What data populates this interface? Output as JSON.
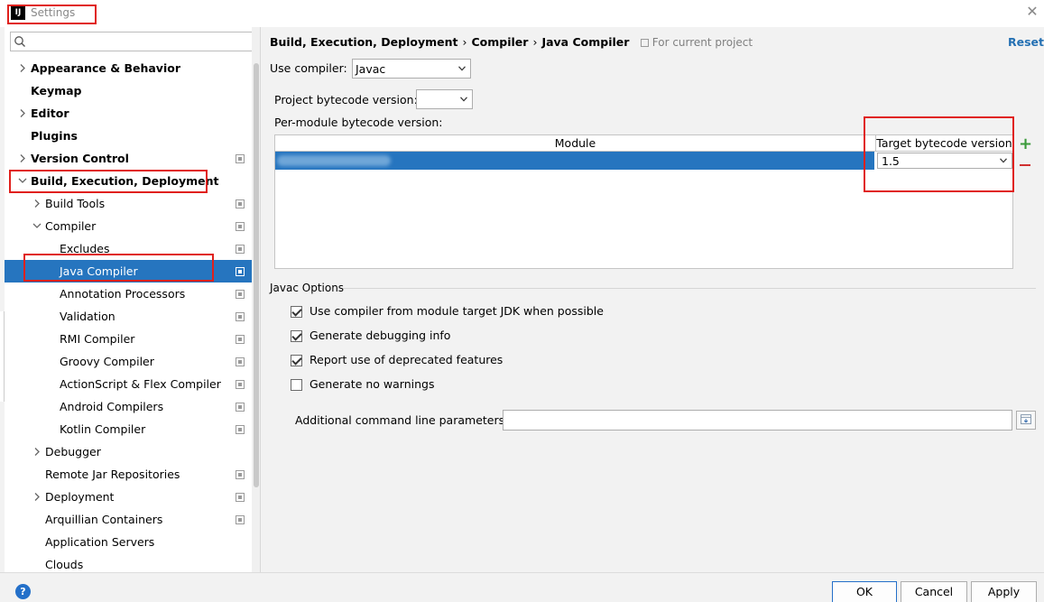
{
  "window": {
    "title": "Settings",
    "logo_text": "IJ",
    "close_glyph": "✕"
  },
  "search": {
    "placeholder": ""
  },
  "sidebar": {
    "items": [
      {
        "label": "Appearance & Behavior",
        "bold": true,
        "chevron": "right",
        "project_icon": false
      },
      {
        "label": "Keymap",
        "bold": true,
        "chevron": "none",
        "project_icon": false
      },
      {
        "label": "Editor",
        "bold": true,
        "chevron": "right",
        "project_icon": false
      },
      {
        "label": "Plugins",
        "bold": true,
        "chevron": "none",
        "project_icon": false
      },
      {
        "label": "Version Control",
        "bold": true,
        "chevron": "right",
        "project_icon": true
      },
      {
        "label": "Build, Execution, Deployment",
        "bold": true,
        "chevron": "down",
        "project_icon": false
      },
      {
        "label": "Build Tools",
        "bold": false,
        "chevron": "right",
        "project_icon": true
      },
      {
        "label": "Compiler",
        "bold": false,
        "chevron": "down",
        "project_icon": true
      },
      {
        "label": "Excludes",
        "bold": false,
        "chevron": "none",
        "project_icon": true
      },
      {
        "label": "Java Compiler",
        "bold": false,
        "chevron": "none",
        "project_icon": true,
        "selected": true
      },
      {
        "label": "Annotation Processors",
        "bold": false,
        "chevron": "none",
        "project_icon": true
      },
      {
        "label": "Validation",
        "bold": false,
        "chevron": "none",
        "project_icon": true
      },
      {
        "label": "RMI Compiler",
        "bold": false,
        "chevron": "none",
        "project_icon": true
      },
      {
        "label": "Groovy Compiler",
        "bold": false,
        "chevron": "none",
        "project_icon": true
      },
      {
        "label": "ActionScript & Flex Compiler",
        "bold": false,
        "chevron": "none",
        "project_icon": true
      },
      {
        "label": "Android Compilers",
        "bold": false,
        "chevron": "none",
        "project_icon": true
      },
      {
        "label": "Kotlin Compiler",
        "bold": false,
        "chevron": "none",
        "project_icon": true
      },
      {
        "label": "Debugger",
        "bold": false,
        "chevron": "right",
        "project_icon": false
      },
      {
        "label": "Remote Jar Repositories",
        "bold": false,
        "chevron": "none",
        "project_icon": true
      },
      {
        "label": "Deployment",
        "bold": false,
        "chevron": "right",
        "project_icon": true
      },
      {
        "label": "Arquillian Containers",
        "bold": false,
        "chevron": "none",
        "project_icon": true
      },
      {
        "label": "Application Servers",
        "bold": false,
        "chevron": "none",
        "project_icon": false
      },
      {
        "label": "Clouds",
        "bold": false,
        "chevron": "none",
        "project_icon": false
      }
    ]
  },
  "breadcrumb": {
    "parts": [
      "Build, Execution, Deployment",
      "Compiler",
      "Java Compiler"
    ],
    "separator": "›",
    "scope_note": "For current project"
  },
  "reset_label": "Reset",
  "use_compiler": {
    "label": "Use compiler:",
    "value": "Javac"
  },
  "project_bytecode": {
    "label": "Project bytecode version:",
    "value": ""
  },
  "per_module": {
    "label": "Per-module bytecode version:",
    "columns": [
      "Module",
      "Target bytecode version"
    ],
    "rows": [
      {
        "module": "",
        "target": "1.5"
      }
    ]
  },
  "javac_options": {
    "title": "Javac Options",
    "checks": [
      {
        "label": "Use compiler from module target JDK when possible",
        "checked": true
      },
      {
        "label": "Generate debugging info",
        "checked": true
      },
      {
        "label": "Report use of deprecated features",
        "checked": true
      },
      {
        "label": "Generate no warnings",
        "checked": false
      }
    ],
    "params_label": "Additional command line parameters:",
    "params_value": ""
  },
  "buttons": {
    "ok": "OK",
    "cancel": "Cancel",
    "apply": "Apply",
    "help": "?"
  },
  "colors": {
    "selection": "#2675bf",
    "link": "#2470b3",
    "highlight_box": "#e0201c",
    "add": "#3a9a3a",
    "remove": "#d03030"
  }
}
